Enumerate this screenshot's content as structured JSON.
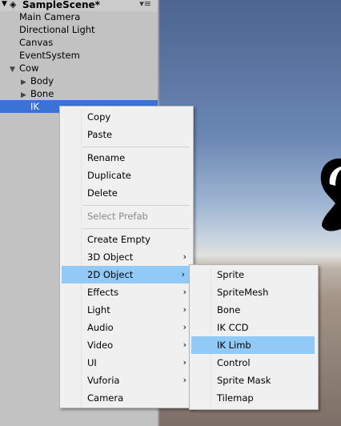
{
  "hierarchy": {
    "scene_title": "SampleScene*",
    "items": [
      {
        "label": "Main Camera"
      },
      {
        "label": "Directional Light"
      },
      {
        "label": "Canvas"
      },
      {
        "label": "EventSystem"
      },
      {
        "label": "Cow"
      },
      {
        "label": "Body"
      },
      {
        "label": "Bone"
      },
      {
        "label": "IK"
      }
    ]
  },
  "context_menu": {
    "items": [
      {
        "label": "Copy"
      },
      {
        "label": "Paste"
      },
      {
        "label": "Rename"
      },
      {
        "label": "Duplicate"
      },
      {
        "label": "Delete"
      },
      {
        "label": "Select Prefab",
        "disabled": true
      },
      {
        "label": "Create Empty"
      },
      {
        "label": "3D Object",
        "submenu": true
      },
      {
        "label": "2D Object",
        "submenu": true,
        "highlighted": true
      },
      {
        "label": "Effects",
        "submenu": true
      },
      {
        "label": "Light",
        "submenu": true
      },
      {
        "label": "Audio",
        "submenu": true
      },
      {
        "label": "Video",
        "submenu": true
      },
      {
        "label": "UI",
        "submenu": true
      },
      {
        "label": "Vuforia",
        "submenu": true
      },
      {
        "label": "Camera"
      }
    ]
  },
  "submenu_2d": {
    "items": [
      {
        "label": "Sprite"
      },
      {
        "label": "SpriteMesh"
      },
      {
        "label": "Bone"
      },
      {
        "label": "IK CCD"
      },
      {
        "label": "IK Limb",
        "highlighted": true
      },
      {
        "label": "Control"
      },
      {
        "label": "Sprite Mask"
      },
      {
        "label": "Tilemap"
      }
    ]
  },
  "icons": {
    "unity_logo": "unity-icon",
    "panel_menu": "panel-menu-icon",
    "submenu_arrow": "chevron-right-icon",
    "collapse": "triangle-down-icon",
    "expand": "triangle-right-icon"
  },
  "colors": {
    "selection": "#3a72d6",
    "menu_highlight": "#91c9f7",
    "panel_bg": "#c2c2c2"
  }
}
